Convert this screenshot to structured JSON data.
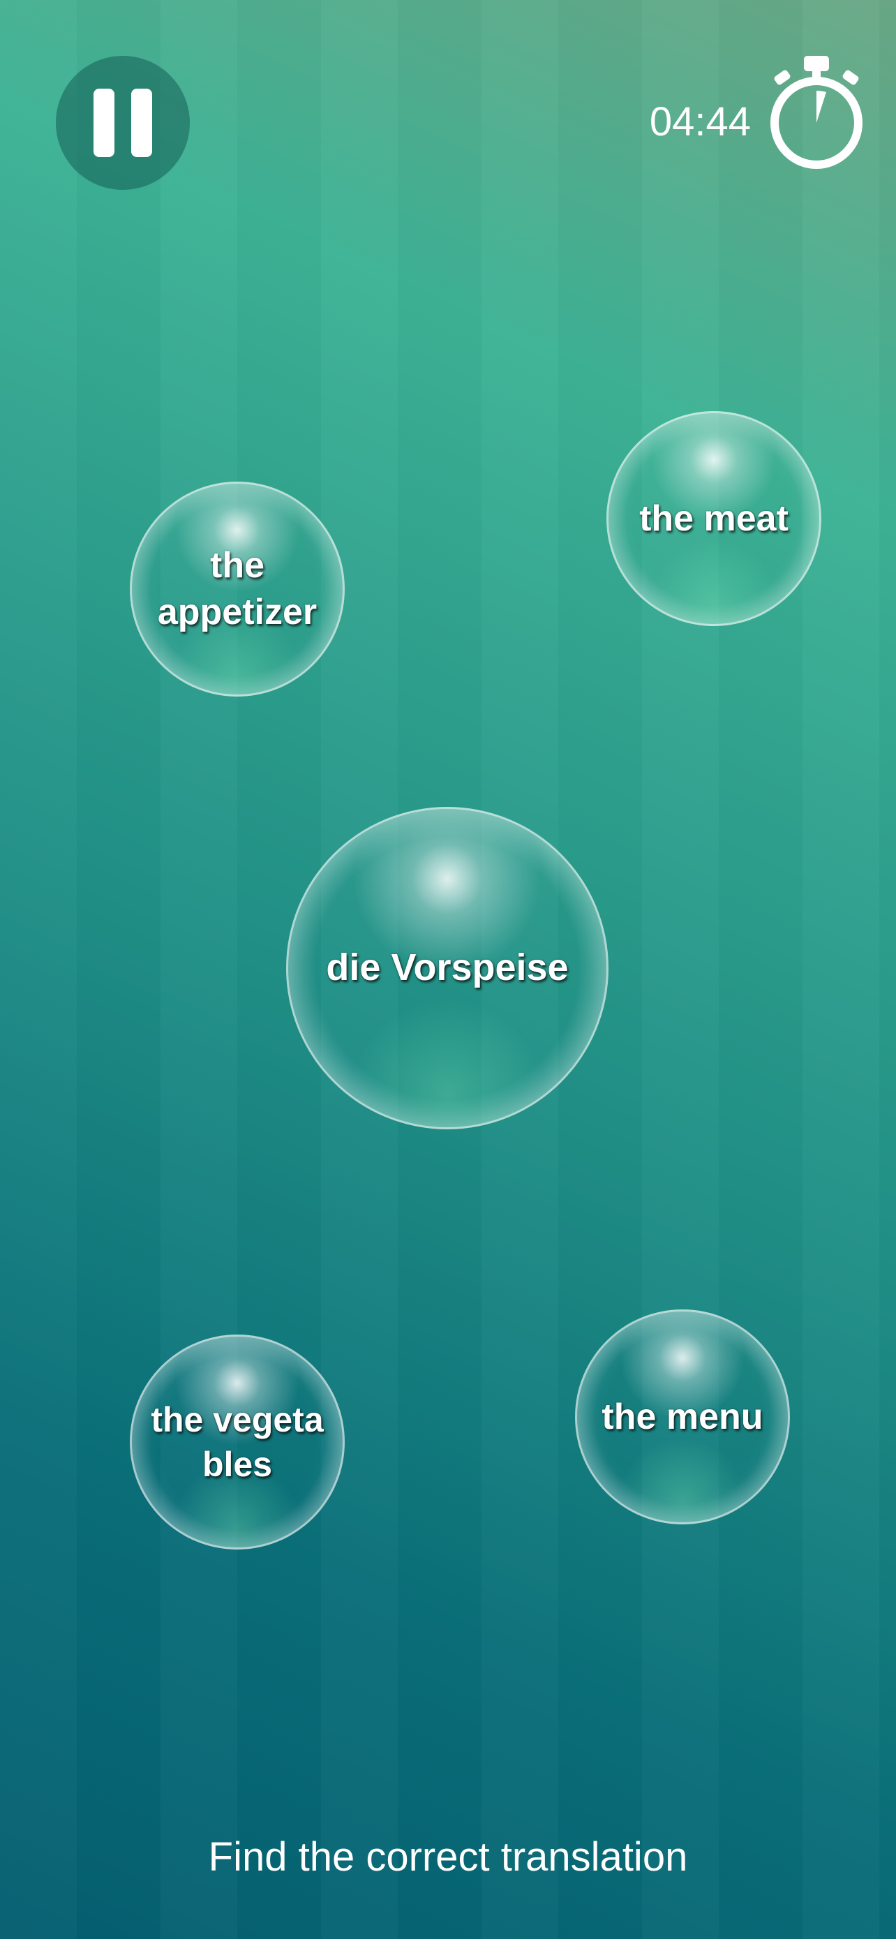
{
  "controls": {
    "pause_icon": "pause-icon",
    "timer_value": "04:44",
    "timer_icon": "stopwatch-icon"
  },
  "bubbles": {
    "appetizer": "the appetizer",
    "meat": "the meat",
    "prompt_word": "die Vorspeise",
    "vegetables": "the vegetables",
    "menu": "the menu"
  },
  "instruction": "Find the correct translation",
  "colors": {
    "background_top": "#3db295",
    "background_bottom": "#045e70",
    "text": "#ffffff"
  }
}
